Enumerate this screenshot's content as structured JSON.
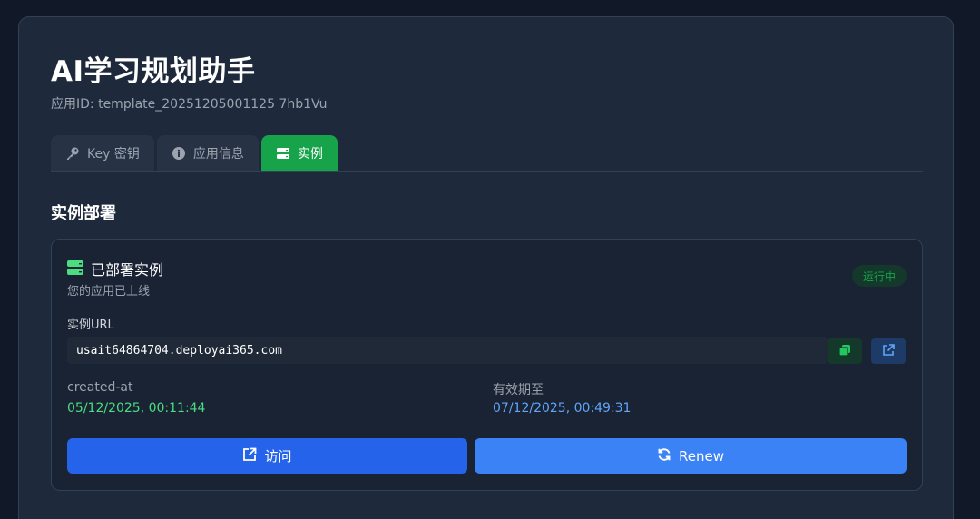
{
  "app": {
    "title": "AI学习规划助手",
    "id_text": "应用ID: template_20251205001125 7hb1Vu"
  },
  "tabs": [
    {
      "label": "Key 密钥",
      "icon": "key-icon",
      "active": false
    },
    {
      "label": "应用信息",
      "icon": "info-icon",
      "active": false
    },
    {
      "label": "实例",
      "icon": "server-icon",
      "active": true
    }
  ],
  "section": {
    "title": "实例部署"
  },
  "instance": {
    "title": "已部署实例",
    "subtitle": "您的应用已上线",
    "status": "运行中",
    "url_label": "实例URL",
    "url": "usait64864704.deployai365.com",
    "created_label": "created-at",
    "created_value": "05/12/2025, 00:11:44",
    "expires_label": "有效期至",
    "expires_value": "07/12/2025, 00:49:31",
    "visit_label": "访问",
    "renew_label": "Renew"
  },
  "colors": {
    "background": "#111827",
    "panel": "#1e293b",
    "active_tab": "#16a34a",
    "visit_button": "#2563eb",
    "renew_button": "#3b82f6",
    "created_value": "#4ade80",
    "expires_value": "#60a5fa"
  }
}
